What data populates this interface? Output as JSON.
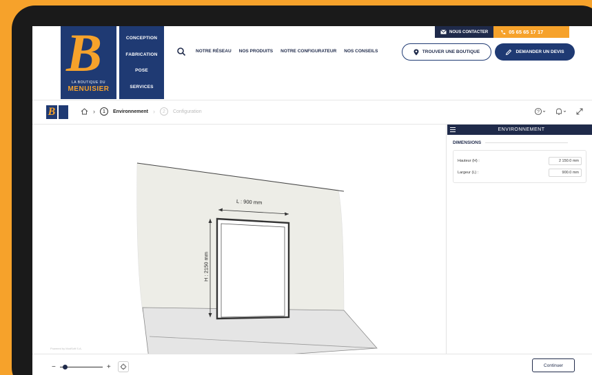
{
  "logo": {
    "small_text": "LA BOUTIQUE DU",
    "big_text": "MENUISIER",
    "letter": "B"
  },
  "services": [
    "CONCEPTION",
    "FABRICATION",
    "POSE",
    "SERVICES"
  ],
  "nav": [
    "NOTRE RÉSEAU",
    "NOS PRODUITS",
    "NOTRE CONFIGURATEUR",
    "NOS CONSEILS"
  ],
  "contact": {
    "label": "NOUS CONTACTER",
    "phone": "05 65 65 17 17"
  },
  "buttons": {
    "boutique": "TROUVER UNE BOUTIQUE",
    "devis": "DEMANDER UN DEVIS",
    "continue": "Continuer"
  },
  "breadcrumb": {
    "step1_num": "1",
    "step1_label": "Environnement",
    "step2_num": "2",
    "step2_label": "Configuration"
  },
  "panel": {
    "title": "ENVIRONNEMENT",
    "section": "DIMENSIONS",
    "fields": [
      {
        "label": "Hauteur (H) :",
        "value": "2 150.0 mm"
      },
      {
        "label": "Largeur (L) :",
        "value": "900.0 mm"
      }
    ]
  },
  "scene": {
    "width_label": "L : 900 mm",
    "height_label": "H : 2150 mm"
  },
  "footer": {
    "powered": "Powered by ModSoft S.A."
  },
  "zoom": {
    "level": 0.07
  },
  "colors": {
    "navy": "#1F3A73",
    "dark_navy": "#1F2A4A",
    "orange": "#F6A22B"
  }
}
